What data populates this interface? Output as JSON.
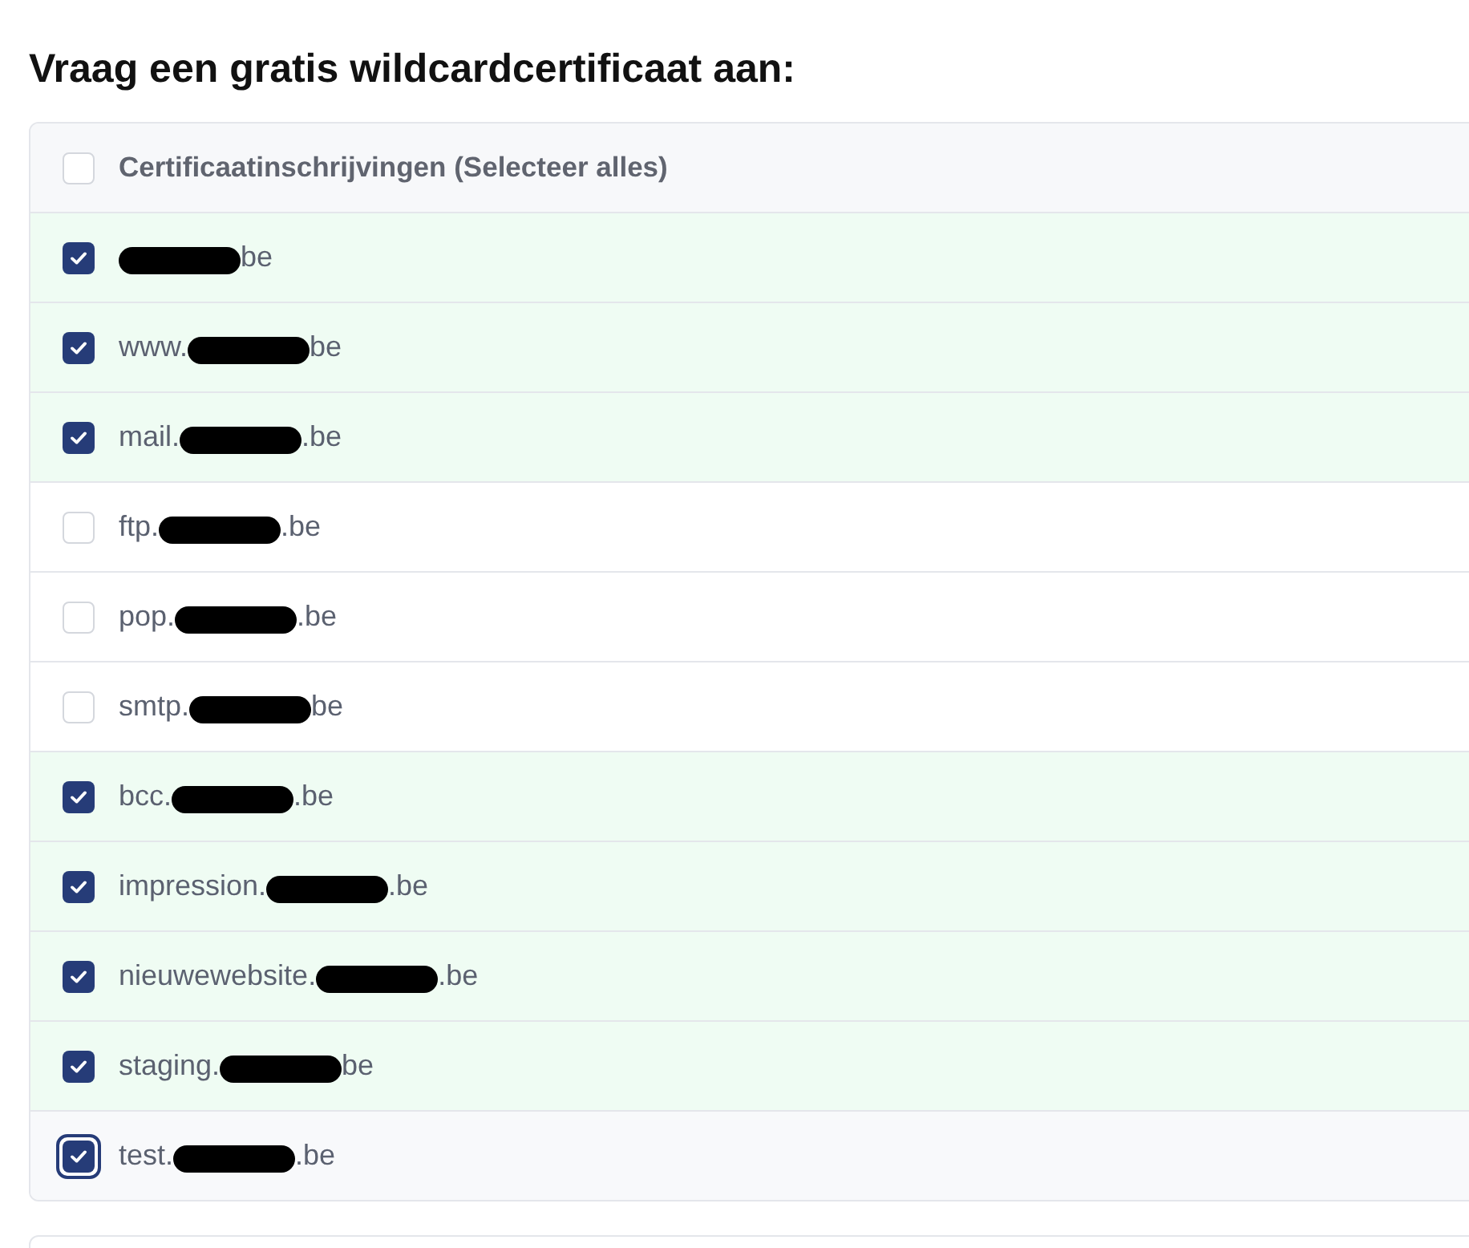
{
  "heading": "Vraag een gratis wildcardcertificaat aan:",
  "list": {
    "header": {
      "label": "Certificaatinschrijvingen (Selecteer alles)",
      "checked": false
    },
    "entries": [
      {
        "suffix": "be",
        "redacted": true,
        "checked": true,
        "focused": false
      },
      {
        "prefix": "www.",
        "suffix": "be",
        "redacted": true,
        "checked": true,
        "focused": false
      },
      {
        "prefix": "mail.",
        "suffix": ".be",
        "redacted": true,
        "checked": true,
        "focused": false
      },
      {
        "prefix": "ftp.",
        "suffix": ".be",
        "redacted": true,
        "checked": false,
        "focused": false
      },
      {
        "prefix": "pop.",
        "suffix": ".be",
        "redacted": true,
        "checked": false,
        "focused": false
      },
      {
        "prefix": "smtp.",
        "suffix": "be",
        "redacted": true,
        "checked": false,
        "focused": false
      },
      {
        "prefix": "bcc.",
        "suffix": ".be",
        "redacted": true,
        "checked": true,
        "focused": false
      },
      {
        "prefix": "impression.",
        "suffix": ".be",
        "redacted": true,
        "checked": true,
        "focused": false
      },
      {
        "prefix": "nieuwewebsite.",
        "suffix": ".be",
        "redacted": true,
        "checked": true,
        "focused": false
      },
      {
        "prefix": "staging.",
        "suffix": "be",
        "redacted": true,
        "checked": true,
        "focused": false
      },
      {
        "prefix": "test.",
        "suffix": ".be",
        "redacted": true,
        "checked": true,
        "focused": true
      }
    ]
  }
}
